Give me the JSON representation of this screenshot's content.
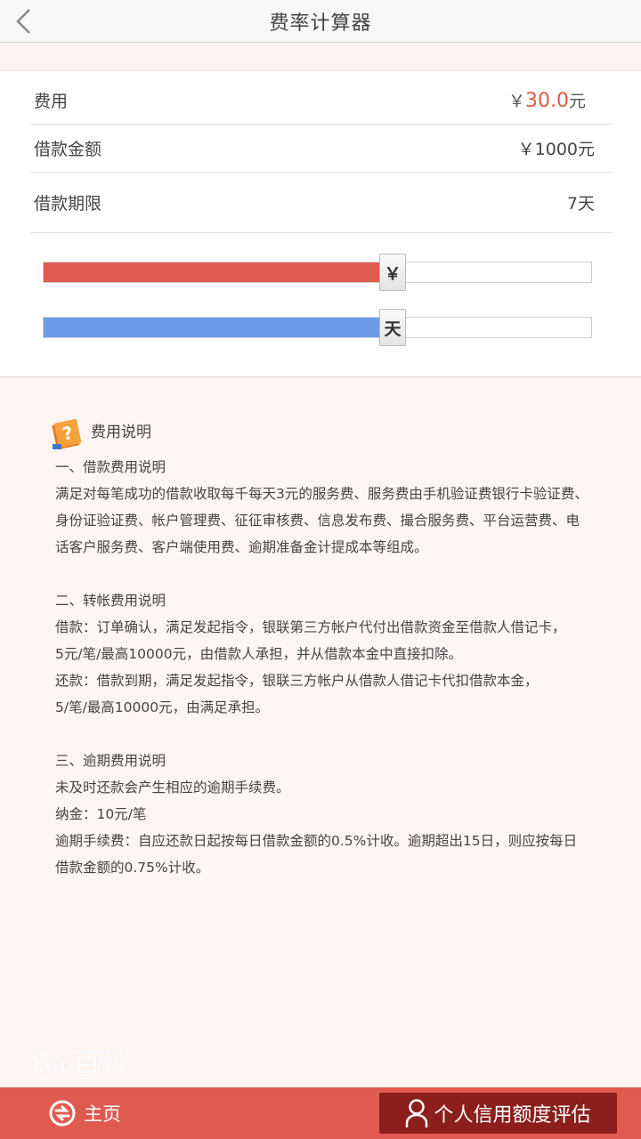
{
  "header": {
    "title": "费率计算器",
    "back_icon": "chevron-left-icon"
  },
  "calculator": {
    "fee": {
      "label": "费用",
      "currency": "￥",
      "amount": "30.0",
      "unit": "元"
    },
    "loan_amount": {
      "label": "借款金额",
      "value": "￥1000元"
    },
    "loan_term": {
      "label": "借款期限",
      "value": "7天"
    },
    "amount_slider": {
      "thumb_label": "￥",
      "fill_fraction": 0.615,
      "color": "#e05b4f"
    },
    "term_slider": {
      "thumb_label": "天",
      "fill_fraction": 0.615,
      "color": "#6b9ae8"
    }
  },
  "notes": {
    "title": "费用说明",
    "icon": "help-book-icon",
    "sections": [
      {
        "heading": "一、借款费用说明",
        "lines": [
          "满足对每笔成功的借款收取每千每天3元的服务费、服务费由手机验证费银行卡验证费、",
          "身份证验证费、帐户管理费、征征审核费、信息发布费、撮合服务费、平台运营费、电",
          "话客户服务费、客户端使用费、逾期准备金计提成本等组成。"
        ]
      },
      {
        "heading": "二、转帐费用说明",
        "lines": [
          "借款：订单确认，满足发起指令，银联第三方帐户代付出借款资金至借款人借记卡，",
          "5元/笔/最高10000元，由借款人承担，并从借款本金中直接扣除。",
          "还款：借款到期，满足发起指令，银联三方帐户从借款人借记卡代扣借款本金，",
          "5/笔/最高10000元，由满足承担。"
        ]
      },
      {
        "heading": "三、逾期费用说明",
        "lines": [
          "未及时还款会产生相应的逾期手续费。",
          "纳金：10元/笔",
          "逾期手续费：自应还款日起按每日借款金额的0.5%计收。逾期超出15日，则应按每日",
          "借款金额的0.75%计收。"
        ]
      }
    ]
  },
  "watermark": {
    "text": "Bai百科"
  },
  "bottom_bar": {
    "home_label": "主页",
    "home_icon": "home-logo-icon",
    "credit_label": "个人信用额度评估",
    "credit_icon": "user-icon",
    "bar_color": "#e05b4f",
    "button_color": "#8c1f1d"
  }
}
